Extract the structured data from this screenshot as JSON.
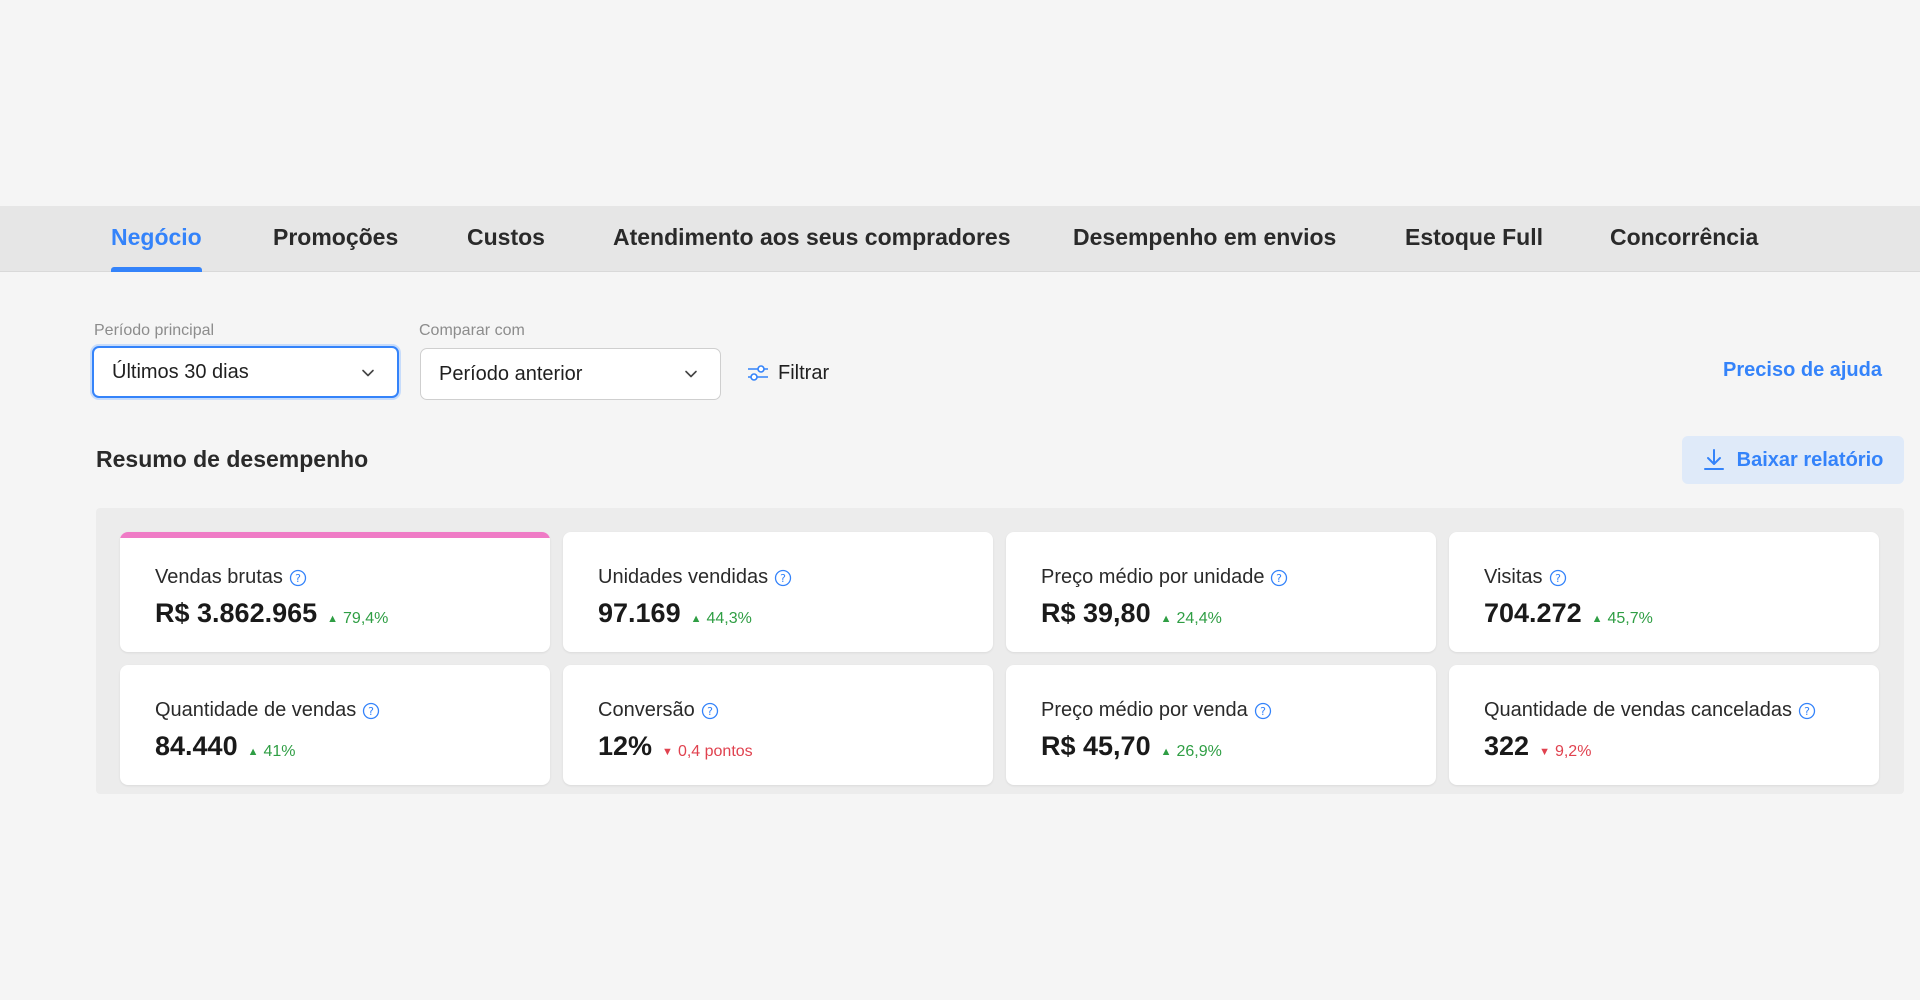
{
  "tabs": [
    {
      "label": "Negócio",
      "active": true
    },
    {
      "label": "Promoções"
    },
    {
      "label": "Custos"
    },
    {
      "label": "Atendimento aos seus compradores"
    },
    {
      "label": "Desempenho em envios"
    },
    {
      "label": "Estoque Full"
    },
    {
      "label": "Concorrência"
    }
  ],
  "filters": {
    "main_period": {
      "label": "Período principal",
      "value": "Últimos 30 dias"
    },
    "compare_with": {
      "label": "Comparar com",
      "value": "Período anterior"
    },
    "filter_button": "Filtrar",
    "help_link": "Preciso de ajuda"
  },
  "summary": {
    "title": "Resumo de desempenho",
    "download_button": "Baixar relatório"
  },
  "metrics": [
    {
      "label": "Vendas brutas",
      "value": "R$ 3.862.965",
      "delta": "79,4%",
      "trend": "up"
    },
    {
      "label": "Unidades vendidas",
      "value": "97.169",
      "delta": "44,3%",
      "trend": "up"
    },
    {
      "label": "Preço médio por unidade",
      "value": "R$ 39,80",
      "delta": "24,4%",
      "trend": "up"
    },
    {
      "label": "Visitas",
      "value": "704.272",
      "delta": "45,7%",
      "trend": "up"
    },
    {
      "label": "Quantidade de vendas",
      "value": "84.440",
      "delta": "41%",
      "trend": "up"
    },
    {
      "label": "Conversão",
      "value": "12%",
      "delta": "0,4 pontos",
      "trend": "down"
    },
    {
      "label": "Preço médio por venda",
      "value": "R$ 45,70",
      "delta": "26,9%",
      "trend": "up"
    },
    {
      "label": "Quantidade de vendas canceladas",
      "value": "322",
      "delta": "9,2%",
      "trend": "down"
    }
  ],
  "colors": {
    "accent": "#3483fa",
    "highlight_bar": "#ef7bc6",
    "positive": "#2f9e44",
    "negative": "#e0424f"
  },
  "icons": {
    "chevron": "chevron-down-icon",
    "filter": "sliders-icon",
    "download": "download-icon",
    "help": "question-circle-icon",
    "up": "triangle-up-icon",
    "down": "triangle-down-icon"
  }
}
